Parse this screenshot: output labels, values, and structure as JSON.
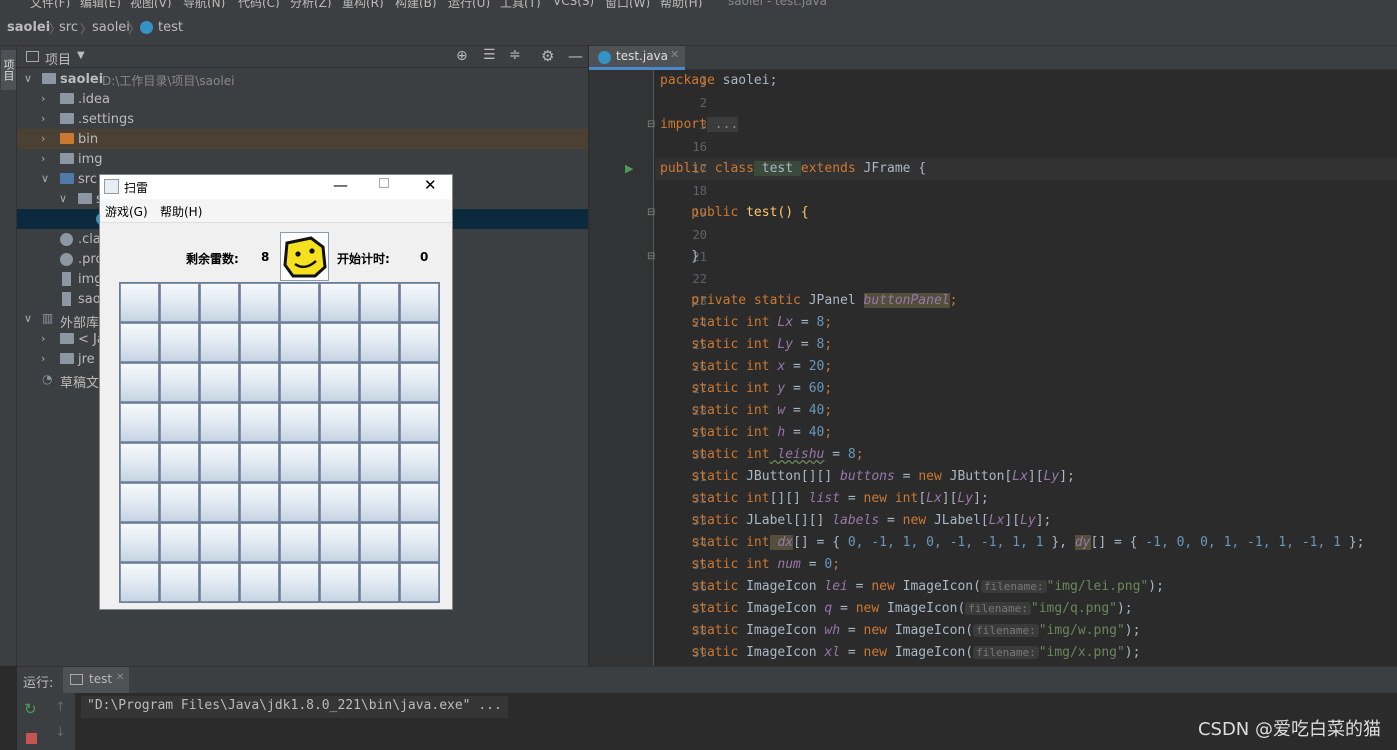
{
  "menubar": [
    "文件(F)",
    "编辑(E)",
    "视图(V)",
    "导航(N)",
    "代码(C)",
    "分析(Z)",
    "重构(R)",
    "构建(B)",
    "运行(U)",
    "工具(T)",
    "VCS(S)",
    "窗口(W)",
    "帮助(H)",
    "saolei - test.java"
  ],
  "breadcrumb": [
    "saolei",
    "src",
    "saolei",
    "test"
  ],
  "sidebar_tab": "项目",
  "project": {
    "header": "项目",
    "rows": [
      {
        "label": "saolei",
        "path": "D:\\工作目录\\项目\\saolei"
      },
      {
        "label": ".idea"
      },
      {
        "label": ".settings"
      },
      {
        "label": "bin"
      },
      {
        "label": "img"
      },
      {
        "label": "src"
      },
      {
        "label": "s"
      },
      {
        "label": ""
      },
      {
        "label": ".cla"
      },
      {
        "label": ".pro"
      },
      {
        "label": "img"
      },
      {
        "label": "sao"
      },
      {
        "label": "外部库"
      },
      {
        "label": "< Ja"
      },
      {
        "label": "jre"
      },
      {
        "label": "草稿文"
      }
    ]
  },
  "editor": {
    "tab": "test.java",
    "lines": [
      {
        "n": "1"
      },
      {
        "n": "2"
      },
      {
        "n": "3"
      },
      {
        "n": "16"
      },
      {
        "n": "17"
      },
      {
        "n": "18"
      },
      {
        "n": "19"
      },
      {
        "n": "20"
      },
      {
        "n": "21"
      },
      {
        "n": "22"
      },
      {
        "n": "23"
      },
      {
        "n": "24"
      },
      {
        "n": "25"
      },
      {
        "n": "26"
      },
      {
        "n": "27"
      },
      {
        "n": "28"
      },
      {
        "n": "29"
      },
      {
        "n": "30"
      },
      {
        "n": "31"
      },
      {
        "n": "32"
      },
      {
        "n": "33"
      },
      {
        "n": "34"
      },
      {
        "n": "35"
      },
      {
        "n": "36"
      },
      {
        "n": "37"
      },
      {
        "n": "38"
      },
      {
        "n": "39"
      }
    ],
    "code": {
      "l1a": "package",
      "l1b": " saolei;",
      "l3a": "import",
      "l3b": " ...",
      "l17a": "public class",
      "l17b": " test ",
      "l17c": "extends",
      "l17d": " JFrame {",
      "l19a": "    public",
      "l19b": " test() {",
      "l21": "    }",
      "l23a": "    private static",
      "l23b": " JPanel ",
      "l23c": "buttonPanel",
      "l23d": ";",
      "l24a": "    static int",
      "l24b": " Lx",
      "l24c": " = ",
      "l24d": "8",
      "l24e": ";",
      "l25a": "    static int",
      "l25b": " Ly",
      "l25c": " = ",
      "l25d": "8",
      "l25e": ";",
      "l26a": "    static int",
      "l26b": " x",
      "l26c": " = ",
      "l26d": "20",
      "l26e": ";",
      "l27a": "    static int",
      "l27b": " y",
      "l27c": " = ",
      "l27d": "60",
      "l27e": ";",
      "l28a": "    static int",
      "l28b": " w",
      "l28c": " = ",
      "l28d": "40",
      "l28e": ";",
      "l29a": "    static int",
      "l29b": " h",
      "l29c": " = ",
      "l29d": "40",
      "l29e": ";",
      "l30a": "    static int",
      "l30b": " leishu",
      "l30c": " = ",
      "l30d": "8",
      "l30e": ";",
      "l31a": "    static",
      "l31b": " JButton[][] ",
      "l31c": "buttons",
      "l31d": " = ",
      "l31e": "new",
      "l31f": " JButton[",
      "l31g": "Lx",
      "l31h": "][",
      "l31i": "Ly",
      "l31j": "];",
      "l32a": "    static int",
      "l32b": "[][] ",
      "l32c": "list",
      "l32d": " = ",
      "l32e": "new int",
      "l32f": "[",
      "l32g": "Lx",
      "l32h": "][",
      "l32i": "Ly",
      "l32j": "];",
      "l33a": "    static",
      "l33b": " JLabel[][] ",
      "l33c": "labels",
      "l33d": " = ",
      "l33e": "new",
      "l33f": " JLabel[",
      "l33g": "Lx",
      "l33h": "][",
      "l33i": "Ly",
      "l33j": "];",
      "l34a": "    static int",
      "l34b": " dx",
      "l34c": "[] = { ",
      "l34d": "0, -1, 1, 0, -1, -1, 1, 1",
      "l34e": " }, ",
      "l34f": "dy",
      "l34g": "[] = { ",
      "l34h": "-1, 0, 0, 1, -1, 1, -1, 1",
      "l34i": " };",
      "l35a": "    static int",
      "l35b": " num",
      "l35c": " = ",
      "l35d": "0",
      "l35e": ";",
      "l36a": "    static",
      "l36b": " ImageIcon ",
      "l36c": "lei",
      "l36d": " = ",
      "l36e": "new",
      "l36f": " ImageIcon(",
      "l36g": "filename:",
      "l36h": "\"img/lei.png\"",
      "l36i": ");",
      "l37a": "    static",
      "l37b": " ImageIcon ",
      "l37c": "q",
      "l37d": " = ",
      "l37e": "new",
      "l37f": " ImageIcon(",
      "l37g": "filename:",
      "l37h": "\"img/q.png\"",
      "l37i": ");",
      "l38a": "    static",
      "l38b": " ImageIcon ",
      "l38c": "wh",
      "l38d": " = ",
      "l38e": "new",
      "l38f": " ImageIcon(",
      "l38g": "filename:",
      "l38h": "\"img/w.png\"",
      "l38i": ");",
      "l39a": "    static",
      "l39b": " ImageIcon ",
      "l39c": "xl",
      "l39d": " = ",
      "l39e": "new",
      "l39f": " ImageIcon(",
      "l39g": "filename:",
      "l39h": "\"img/x.png\"",
      "l39i": ");"
    }
  },
  "run": {
    "label": "运行:",
    "tab": "test",
    "output": "\"D:\\Program Files\\Java\\jdk1.8.0_221\\bin\\java.exe\" ..."
  },
  "minesweeper": {
    "title": "扫雷",
    "menu_game": "游戏(G)",
    "menu_help": "帮助(H)",
    "mines_label": "剩余雷数:",
    "mines_value": "8",
    "timer_label": "开始计时:",
    "timer_value": "0",
    "grid_cols": 8,
    "grid_rows": 8
  },
  "watermark": "CSDN @爱吃白菜的猫",
  "colors": {
    "keyword": "#cc7832",
    "number": "#6897bb",
    "string": "#6a8759",
    "field": "#9876aa"
  }
}
